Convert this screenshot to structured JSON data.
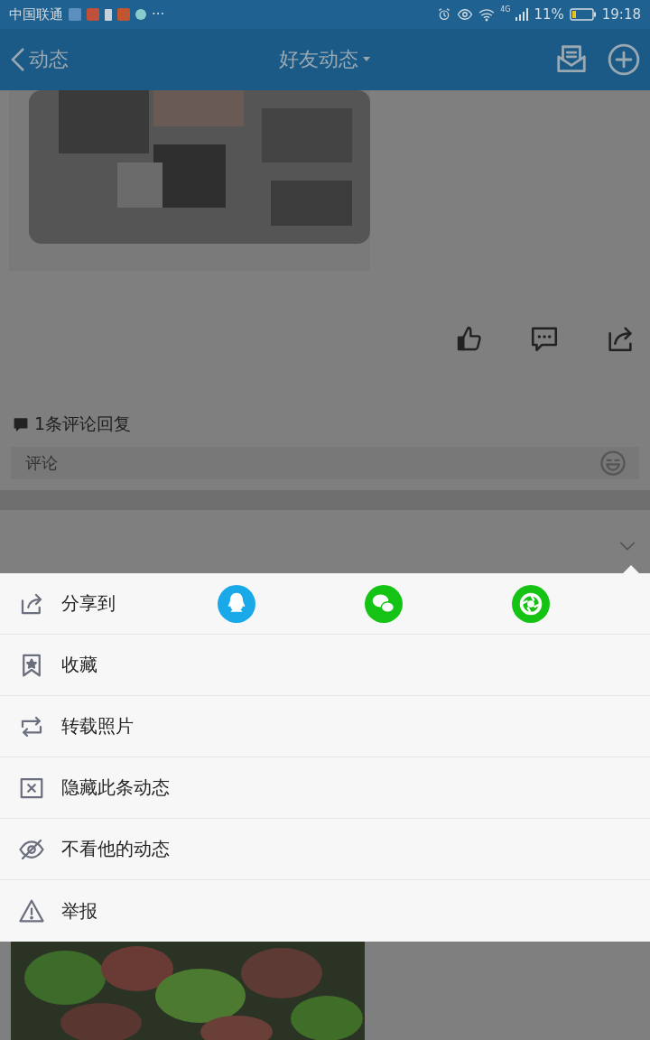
{
  "status_bar": {
    "carrier": "中国联通",
    "more": "···",
    "network": "4G",
    "battery": "11%",
    "time": "19:18"
  },
  "nav": {
    "back_label": "动态",
    "title": "好友动态"
  },
  "post": {
    "comment_count": "1条评论回复",
    "comment_placeholder": "评论"
  },
  "menu": {
    "items": [
      {
        "kind": "share",
        "label": "分享到",
        "targets": [
          {
            "kind": "qq",
            "color": "#1aa9e8"
          },
          {
            "kind": "wechat",
            "color": "#14c314"
          },
          {
            "kind": "moments",
            "color": "#14c314"
          }
        ]
      },
      {
        "kind": "favorite",
        "label": "收藏"
      },
      {
        "kind": "repost",
        "label": "转载照片"
      },
      {
        "kind": "hide",
        "label": "隐藏此条动态"
      },
      {
        "kind": "unfollow",
        "label": "不看他的动态"
      },
      {
        "kind": "report",
        "label": "举报"
      }
    ]
  }
}
